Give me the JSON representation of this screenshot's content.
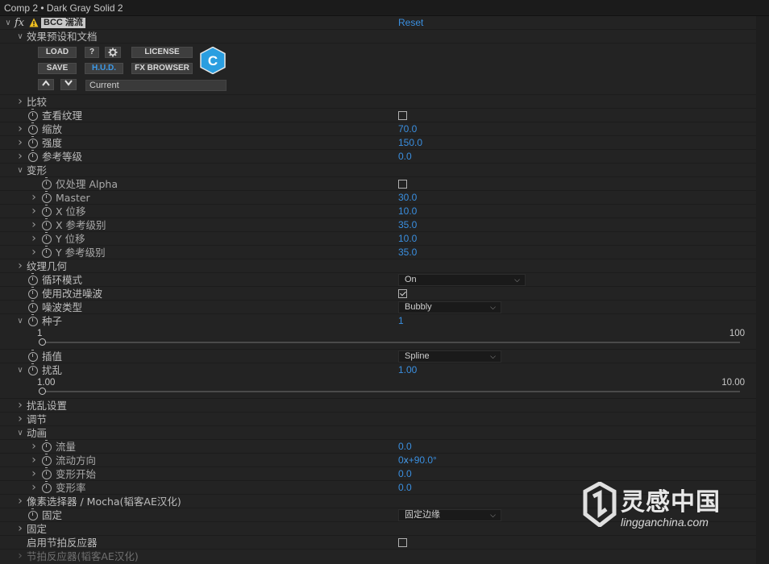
{
  "window": {
    "title": "Comp 2 • Dark Gray Solid 2"
  },
  "effect": {
    "fx_label": "fx",
    "name": "BCC 湍流",
    "reset_label": "Reset"
  },
  "presets": {
    "group_label": "效果预设和文档",
    "buttons": {
      "load": "LOAD",
      "help": "?",
      "license": "LICENSE",
      "save": "SAVE",
      "hud": "H.U.D.",
      "fx_browser": "FX BROWSER"
    },
    "current": "Current",
    "logo_letter": "C"
  },
  "params": {
    "compare": "比较",
    "view_texture": "查看纹理",
    "scale": {
      "label": "缩放",
      "value": "70.0"
    },
    "strength": {
      "label": "强度",
      "value": "150.0"
    },
    "ref_level": {
      "label": "参考等级",
      "value": "0.0"
    },
    "transform": "变形",
    "alpha_only": "仅处理 Alpha",
    "master": {
      "label": "Master",
      "value": "30.0"
    },
    "x_offset": {
      "label": "X 位移",
      "value": "10.0"
    },
    "x_ref": {
      "label": "X 参考级别",
      "value": "35.0"
    },
    "y_offset": {
      "label": "Y 位移",
      "value": "10.0"
    },
    "y_ref": {
      "label": "Y 参考级别",
      "value": "35.0"
    },
    "tex_geometry": "纹理几何",
    "loop_mode": {
      "label": "循环模式",
      "value": "On"
    },
    "improved_noise": "使用改进噪波",
    "noise_type": {
      "label": "噪波类型",
      "value": "Bubbly"
    },
    "seed": {
      "label": "种子",
      "value": "1",
      "min": "1",
      "max": "100",
      "level": 0.0
    },
    "interp": {
      "label": "插值",
      "value": "Spline"
    },
    "disturb": {
      "label": "扰乱",
      "value": "1.00",
      "min": "1.00",
      "max": "10.00",
      "level": 0.0
    },
    "disturb_settings": "扰乱设置",
    "adjust": "调节",
    "animation": "动画",
    "flow": {
      "label": "流量",
      "value": "0.0"
    },
    "flow_dir": {
      "label": "流动方向",
      "value_rev": "0",
      "value_x": "x",
      "value_deg": "+90.0°"
    },
    "morph_start": {
      "label": "变形开始",
      "value": "0.0"
    },
    "morph_rate": {
      "label": "变形率",
      "value": "0.0"
    },
    "pixel_chooser": "像素选择器 / Mocha(韬客AE汉化)",
    "fixed": {
      "label": "固定",
      "value": "固定边缘"
    },
    "fixed_group": "固定",
    "beat_reactor_enable": "启用节拍反应器",
    "beat_reactor": "节拍反应器(韬客AE汉化)"
  },
  "watermark": {
    "brand": "灵感中国",
    "url": "lingganchina.com"
  },
  "colors": {
    "value_blue": "#3a8fe0",
    "background": "#232323"
  }
}
